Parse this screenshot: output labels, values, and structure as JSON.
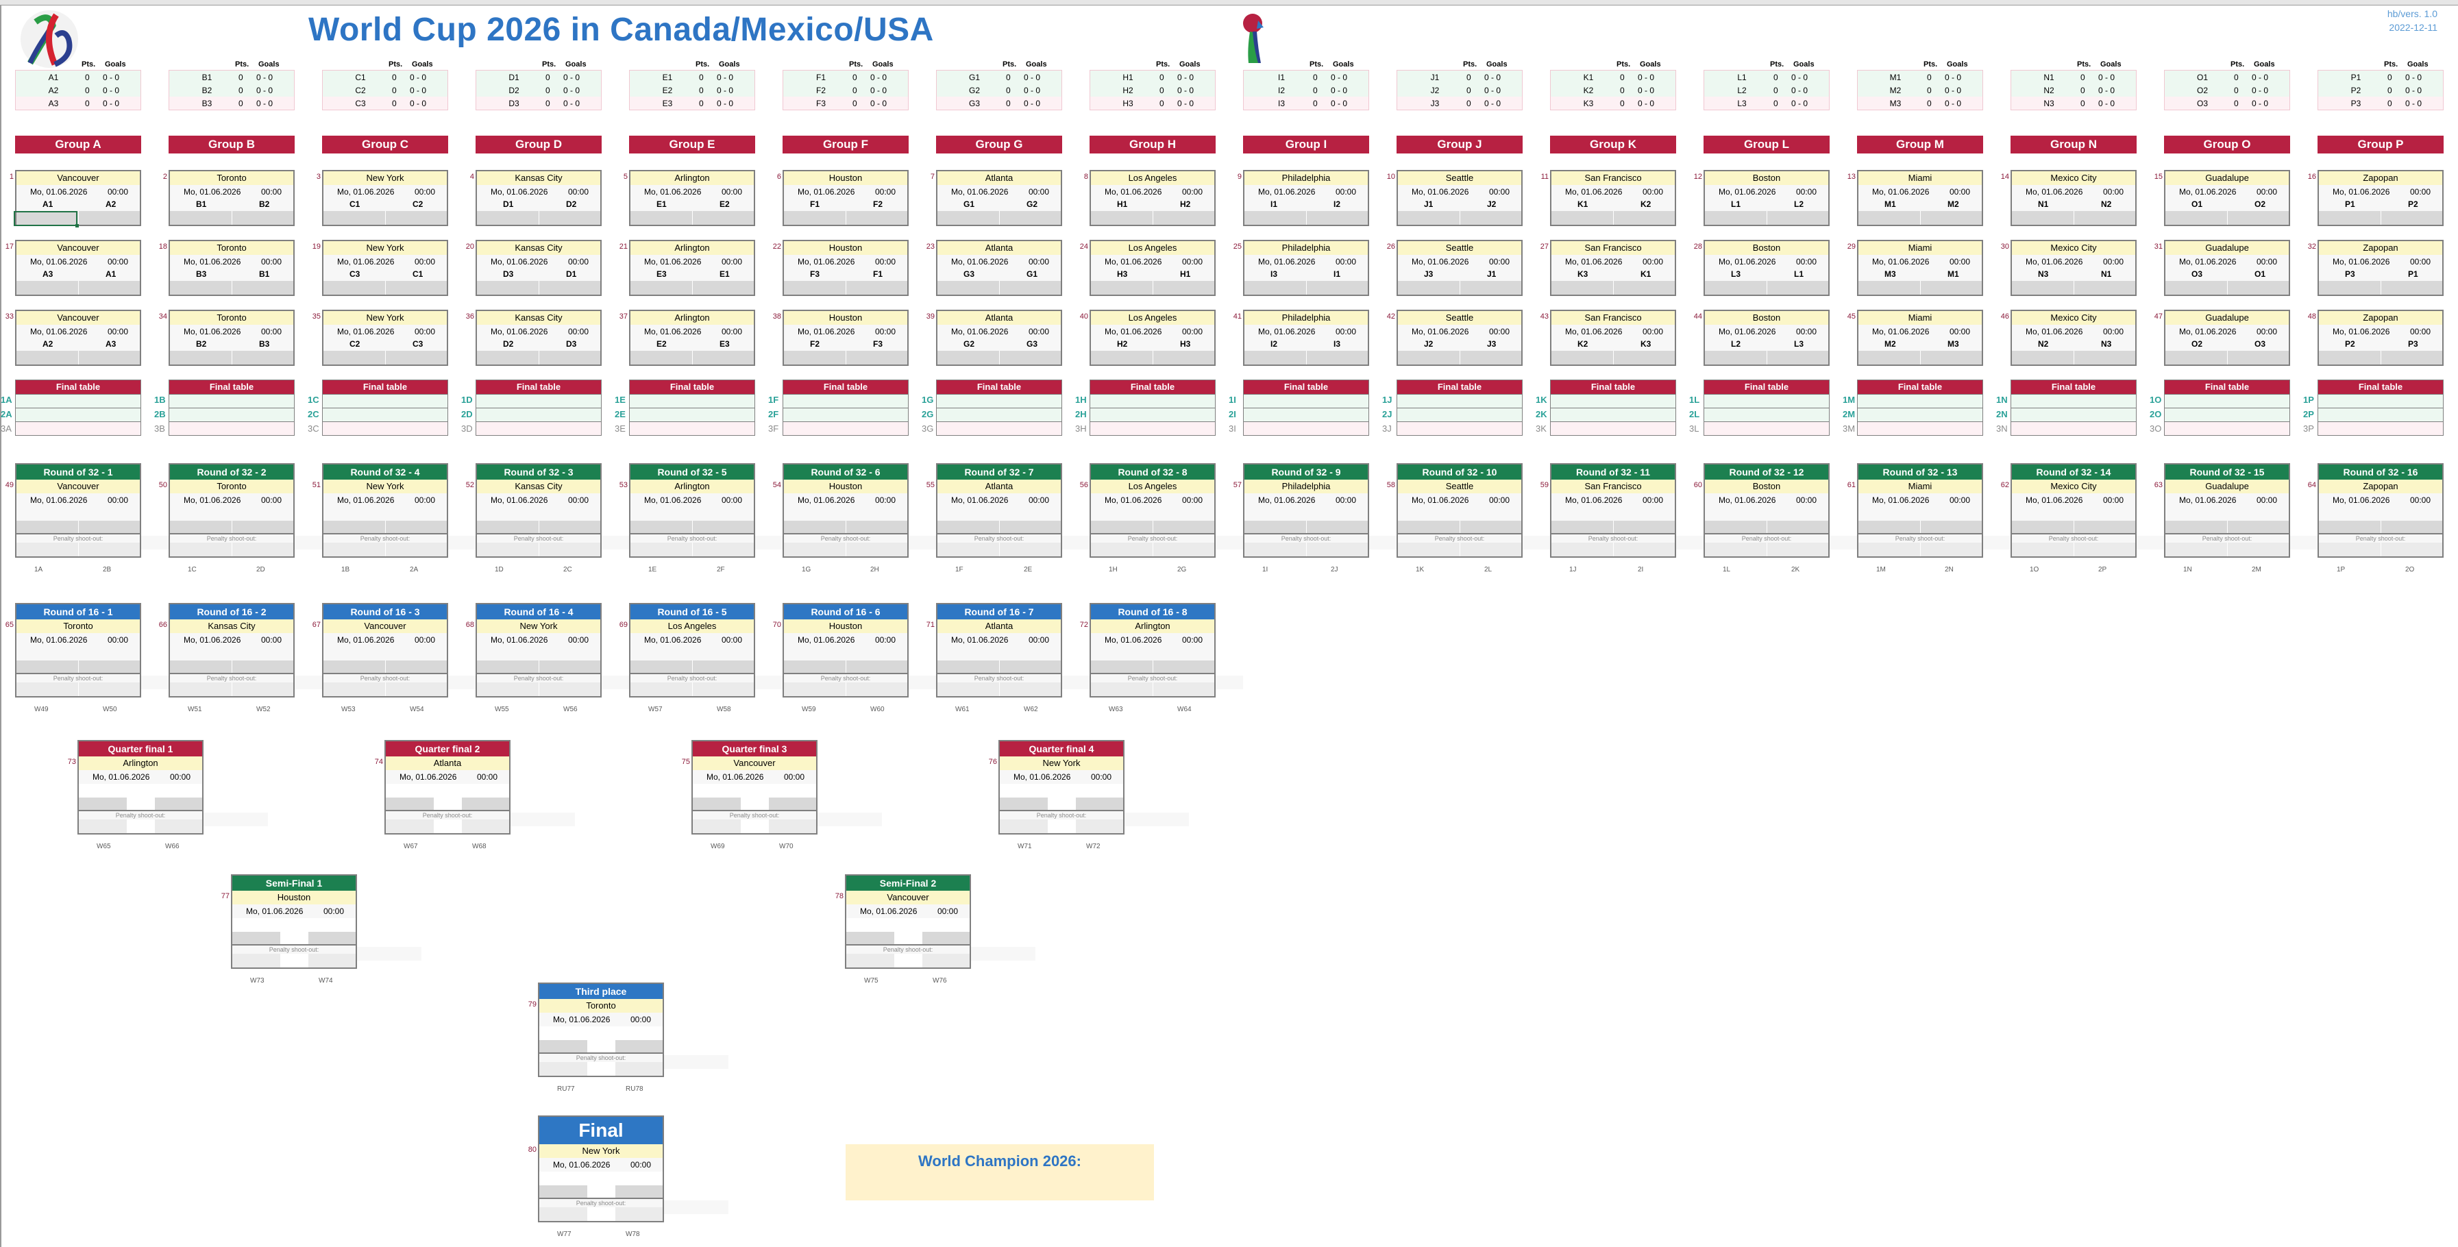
{
  "header": {
    "title": "World Cup 2026 in Canada/Mexico/USA",
    "version": "hb/vers. 1.0",
    "date": "2022-12-11",
    "logo_icon": "wc2026-logo-icon",
    "trophy_icon": "trophy-icon"
  },
  "colors": {
    "group_red": "#b72142",
    "r32_green": "#1c8050",
    "r16_blue": "#2e77c4",
    "venue_yellow": "#fbf6c8",
    "title_blue": "#2e75c4"
  },
  "labels": {
    "pts": "Pts.",
    "goals": "Goals",
    "final_table": "Final table",
    "penalty": "Penalty shoot-out:",
    "default_date": "Mo, 01.06.2026",
    "default_time": "00:00",
    "champion": "World Champion 2026:"
  },
  "groups": [
    {
      "letter": "A",
      "name": "Group A",
      "venue": "Vancouver",
      "matches": [
        {
          "num": "1",
          "home": "A1",
          "away": "A2"
        },
        {
          "num": "17",
          "home": "A3",
          "away": "A1"
        },
        {
          "num": "33",
          "home": "A2",
          "away": "A3"
        }
      ]
    },
    {
      "letter": "B",
      "name": "Group B",
      "venue": "Toronto",
      "matches": [
        {
          "num": "2",
          "home": "B1",
          "away": "B2"
        },
        {
          "num": "18",
          "home": "B3",
          "away": "B1"
        },
        {
          "num": "34",
          "home": "B2",
          "away": "B3"
        }
      ]
    },
    {
      "letter": "C",
      "name": "Group C",
      "venue": "New York",
      "matches": [
        {
          "num": "3",
          "home": "C1",
          "away": "C2"
        },
        {
          "num": "19",
          "home": "C3",
          "away": "C1"
        },
        {
          "num": "35",
          "home": "C2",
          "away": "C3"
        }
      ]
    },
    {
      "letter": "D",
      "name": "Group D",
      "venue": "Kansas City",
      "matches": [
        {
          "num": "4",
          "home": "D1",
          "away": "D2"
        },
        {
          "num": "20",
          "home": "D3",
          "away": "D1"
        },
        {
          "num": "36",
          "home": "D2",
          "away": "D3"
        }
      ]
    },
    {
      "letter": "E",
      "name": "Group E",
      "venue": "Arlington",
      "matches": [
        {
          "num": "5",
          "home": "E1",
          "away": "E2"
        },
        {
          "num": "21",
          "home": "E3",
          "away": "E1"
        },
        {
          "num": "37",
          "home": "E2",
          "away": "E3"
        }
      ]
    },
    {
      "letter": "F",
      "name": "Group F",
      "venue": "Houston",
      "matches": [
        {
          "num": "6",
          "home": "F1",
          "away": "F2"
        },
        {
          "num": "22",
          "home": "F3",
          "away": "F1"
        },
        {
          "num": "38",
          "home": "F2",
          "away": "F3"
        }
      ]
    },
    {
      "letter": "G",
      "name": "Group G",
      "venue": "Atlanta",
      "matches": [
        {
          "num": "7",
          "home": "G1",
          "away": "G2"
        },
        {
          "num": "23",
          "home": "G3",
          "away": "G1"
        },
        {
          "num": "39",
          "home": "G2",
          "away": "G3"
        }
      ]
    },
    {
      "letter": "H",
      "name": "Group H",
      "venue": "Los Angeles",
      "matches": [
        {
          "num": "8",
          "home": "H1",
          "away": "H2"
        },
        {
          "num": "24",
          "home": "H3",
          "away": "H1"
        },
        {
          "num": "40",
          "home": "H2",
          "away": "H3"
        }
      ]
    },
    {
      "letter": "I",
      "name": "Group I",
      "venue": "Philadelphia",
      "matches": [
        {
          "num": "9",
          "home": "I1",
          "away": "I2"
        },
        {
          "num": "25",
          "home": "I3",
          "away": "I1"
        },
        {
          "num": "41",
          "home": "I2",
          "away": "I3"
        }
      ]
    },
    {
      "letter": "J",
      "name": "Group J",
      "venue": "Seattle",
      "matches": [
        {
          "num": "10",
          "home": "J1",
          "away": "J2"
        },
        {
          "num": "26",
          "home": "J3",
          "away": "J1"
        },
        {
          "num": "42",
          "home": "J2",
          "away": "J3"
        }
      ]
    },
    {
      "letter": "K",
      "name": "Group K",
      "venue": "San Francisco",
      "matches": [
        {
          "num": "11",
          "home": "K1",
          "away": "K2"
        },
        {
          "num": "27",
          "home": "K3",
          "away": "K1"
        },
        {
          "num": "43",
          "home": "K2",
          "away": "K3"
        }
      ]
    },
    {
      "letter": "L",
      "name": "Group L",
      "venue": "Boston",
      "matches": [
        {
          "num": "12",
          "home": "L1",
          "away": "L2"
        },
        {
          "num": "28",
          "home": "L3",
          "away": "L1"
        },
        {
          "num": "44",
          "home": "L2",
          "away": "L3"
        }
      ]
    },
    {
      "letter": "M",
      "name": "Group M",
      "venue": "Miami",
      "matches": [
        {
          "num": "13",
          "home": "M1",
          "away": "M2"
        },
        {
          "num": "29",
          "home": "M3",
          "away": "M1"
        },
        {
          "num": "45",
          "home": "M2",
          "away": "M3"
        }
      ]
    },
    {
      "letter": "N",
      "name": "Group N",
      "venue": "Mexico City",
      "matches": [
        {
          "num": "14",
          "home": "N1",
          "away": "N2"
        },
        {
          "num": "30",
          "home": "N3",
          "away": "N1"
        },
        {
          "num": "46",
          "home": "N2",
          "away": "N3"
        }
      ]
    },
    {
      "letter": "O",
      "name": "Group O",
      "venue": "Guadalupe",
      "matches": [
        {
          "num": "15",
          "home": "O1",
          "away": "O2"
        },
        {
          "num": "31",
          "home": "O3",
          "away": "O1"
        },
        {
          "num": "47",
          "home": "O2",
          "away": "O3"
        }
      ]
    },
    {
      "letter": "P",
      "name": "Group P",
      "venue": "Zapopan",
      "matches": [
        {
          "num": "16",
          "home": "P1",
          "away": "P2"
        },
        {
          "num": "32",
          "home": "P3",
          "away": "P1"
        },
        {
          "num": "48",
          "home": "P2",
          "away": "P3"
        }
      ]
    }
  ],
  "round_of_32": [
    {
      "title": "Round of 32 - 1",
      "num": "49",
      "venue": "Vancouver",
      "home": "1A",
      "away": "2B"
    },
    {
      "title": "Round of 32 - 2",
      "num": "50",
      "venue": "Toronto",
      "home": "1C",
      "away": "2D"
    },
    {
      "title": "Round of 32 - 4",
      "num": "51",
      "venue": "New York",
      "home": "1B",
      "away": "2A"
    },
    {
      "title": "Round of 32 - 3",
      "num": "52",
      "venue": "Kansas City",
      "home": "1D",
      "away": "2C"
    },
    {
      "title": "Round of 32 - 5",
      "num": "53",
      "venue": "Arlington",
      "home": "1E",
      "away": "2F"
    },
    {
      "title": "Round of 32 - 6",
      "num": "54",
      "venue": "Houston",
      "home": "1G",
      "away": "2H"
    },
    {
      "title": "Round of 32 - 7",
      "num": "55",
      "venue": "Atlanta",
      "home": "1F",
      "away": "2E"
    },
    {
      "title": "Round of 32 - 8",
      "num": "56",
      "venue": "Los Angeles",
      "home": "1H",
      "away": "2G"
    },
    {
      "title": "Round of 32 - 9",
      "num": "57",
      "venue": "Philadelphia",
      "home": "1I",
      "away": "2J"
    },
    {
      "title": "Round of 32 - 10",
      "num": "58",
      "venue": "Seattle",
      "home": "1K",
      "away": "2L"
    },
    {
      "title": "Round of 32 - 11",
      "num": "59",
      "venue": "San Francisco",
      "home": "1J",
      "away": "2I"
    },
    {
      "title": "Round of 32 - 12",
      "num": "60",
      "venue": "Boston",
      "home": "1L",
      "away": "2K"
    },
    {
      "title": "Round of 32 - 13",
      "num": "61",
      "venue": "Miami",
      "home": "1M",
      "away": "2N"
    },
    {
      "title": "Round of 32 - 14",
      "num": "62",
      "venue": "Mexico City",
      "home": "1O",
      "away": "2P"
    },
    {
      "title": "Round of 32 - 15",
      "num": "63",
      "venue": "Guadalupe",
      "home": "1N",
      "away": "2M"
    },
    {
      "title": "Round of 32 - 16",
      "num": "64",
      "venue": "Zapopan",
      "home": "1P",
      "away": "2O"
    }
  ],
  "round_of_16": [
    {
      "title": "Round of 16 - 1",
      "num": "65",
      "venue": "Toronto",
      "home": "W49",
      "away": "W50"
    },
    {
      "title": "Round of 16 - 2",
      "num": "66",
      "venue": "Kansas City",
      "home": "W51",
      "away": "W52"
    },
    {
      "title": "Round of 16 - 3",
      "num": "67",
      "venue": "Vancouver",
      "home": "W53",
      "away": "W54"
    },
    {
      "title": "Round of 16 - 4",
      "num": "68",
      "venue": "New York",
      "home": "W55",
      "away": "W56"
    },
    {
      "title": "Round of 16 - 5",
      "num": "69",
      "venue": "Los Angeles",
      "home": "W57",
      "away": "W58"
    },
    {
      "title": "Round of 16 - 6",
      "num": "70",
      "venue": "Houston",
      "home": "W59",
      "away": "W60"
    },
    {
      "title": "Round of 16 - 7",
      "num": "71",
      "venue": "Atlanta",
      "home": "W61",
      "away": "W62"
    },
    {
      "title": "Round of 16 - 8",
      "num": "72",
      "venue": "Arlington",
      "home": "W63",
      "away": "W64"
    }
  ],
  "quarter_finals": [
    {
      "title": "Quarter final 1",
      "num": "73",
      "venue": "Arlington",
      "home": "W65",
      "away": "W66"
    },
    {
      "title": "Quarter final 2",
      "num": "74",
      "venue": "Atlanta",
      "home": "W67",
      "away": "W68"
    },
    {
      "title": "Quarter final 3",
      "num": "75",
      "venue": "Vancouver",
      "home": "W69",
      "away": "W70"
    },
    {
      "title": "Quarter final 4",
      "num": "76",
      "venue": "New York",
      "home": "W71",
      "away": "W72"
    }
  ],
  "semi_finals": [
    {
      "title": "Semi-Final 1",
      "num": "77",
      "venue": "Houston",
      "home": "W73",
      "away": "W74"
    },
    {
      "title": "Semi-Final 2",
      "num": "78",
      "venue": "Vancouver",
      "home": "W75",
      "away": "W76"
    }
  ],
  "third_place": {
    "title": "Third place",
    "num": "79",
    "venue": "Toronto",
    "home": "RU77",
    "away": "RU78"
  },
  "final": {
    "title": "Final",
    "num": "80",
    "venue": "New York",
    "home": "W77",
    "away": "W78"
  }
}
